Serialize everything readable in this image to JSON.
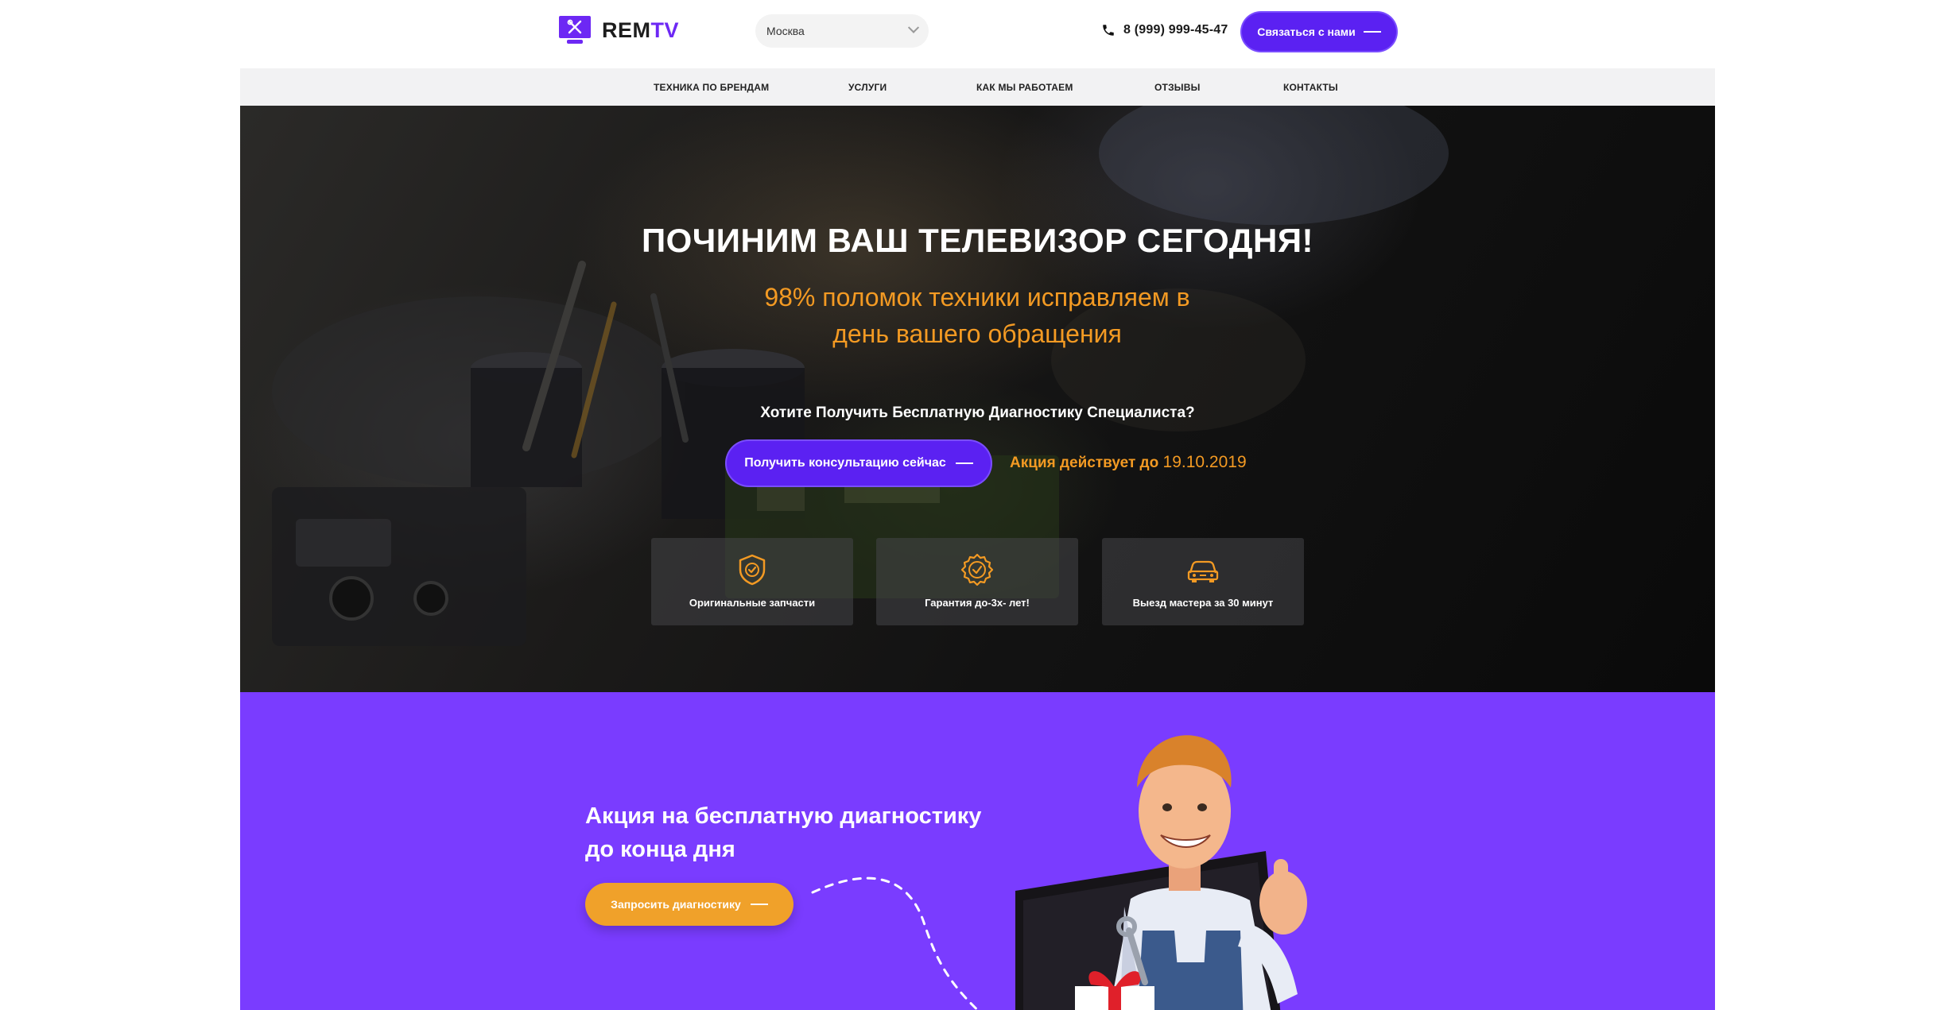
{
  "header": {
    "logo_main": "REM",
    "logo_accent": "TV",
    "city": "Москва",
    "phone": "8 (999) 999-45-47",
    "contact_button": "Связаться с нами"
  },
  "nav": {
    "items": [
      {
        "label": "ТЕХНИКА ПО БРЕНДАМ"
      },
      {
        "label": "УСЛУГИ"
      },
      {
        "label": "КАК МЫ РАБОТАЕМ"
      },
      {
        "label": "ОТЗЫВЫ"
      },
      {
        "label": "КОНТАКТЫ"
      }
    ]
  },
  "hero": {
    "title": "ПОЧИНИМ ВАШ ТЕЛЕВИЗОР СЕГОДНЯ!",
    "subtitle": "98% поломок техники исправляем в день вашего обращения",
    "question": "Хотите Получить Бесплатную Диагностику Специалиста?",
    "consult_button": "Получить консультацию сейчас",
    "promo_text": "Акция действует до",
    "promo_date": "19.10.2019",
    "features": [
      {
        "label": "Оригинальные запчасти",
        "icon": "shield-check-icon"
      },
      {
        "label": "Гарантия до-3х- лет!",
        "icon": "badge-check-icon"
      },
      {
        "label": "Выезд мастера за 30 минут",
        "icon": "car-icon"
      }
    ]
  },
  "promo": {
    "title": "Акция на бесплатную диагностику до конца дня",
    "button": "Запросить диагностику"
  },
  "colors": {
    "brand": "#6d28f4",
    "accent_orange": "#f39a23",
    "promo_bg": "#7a3cff"
  }
}
